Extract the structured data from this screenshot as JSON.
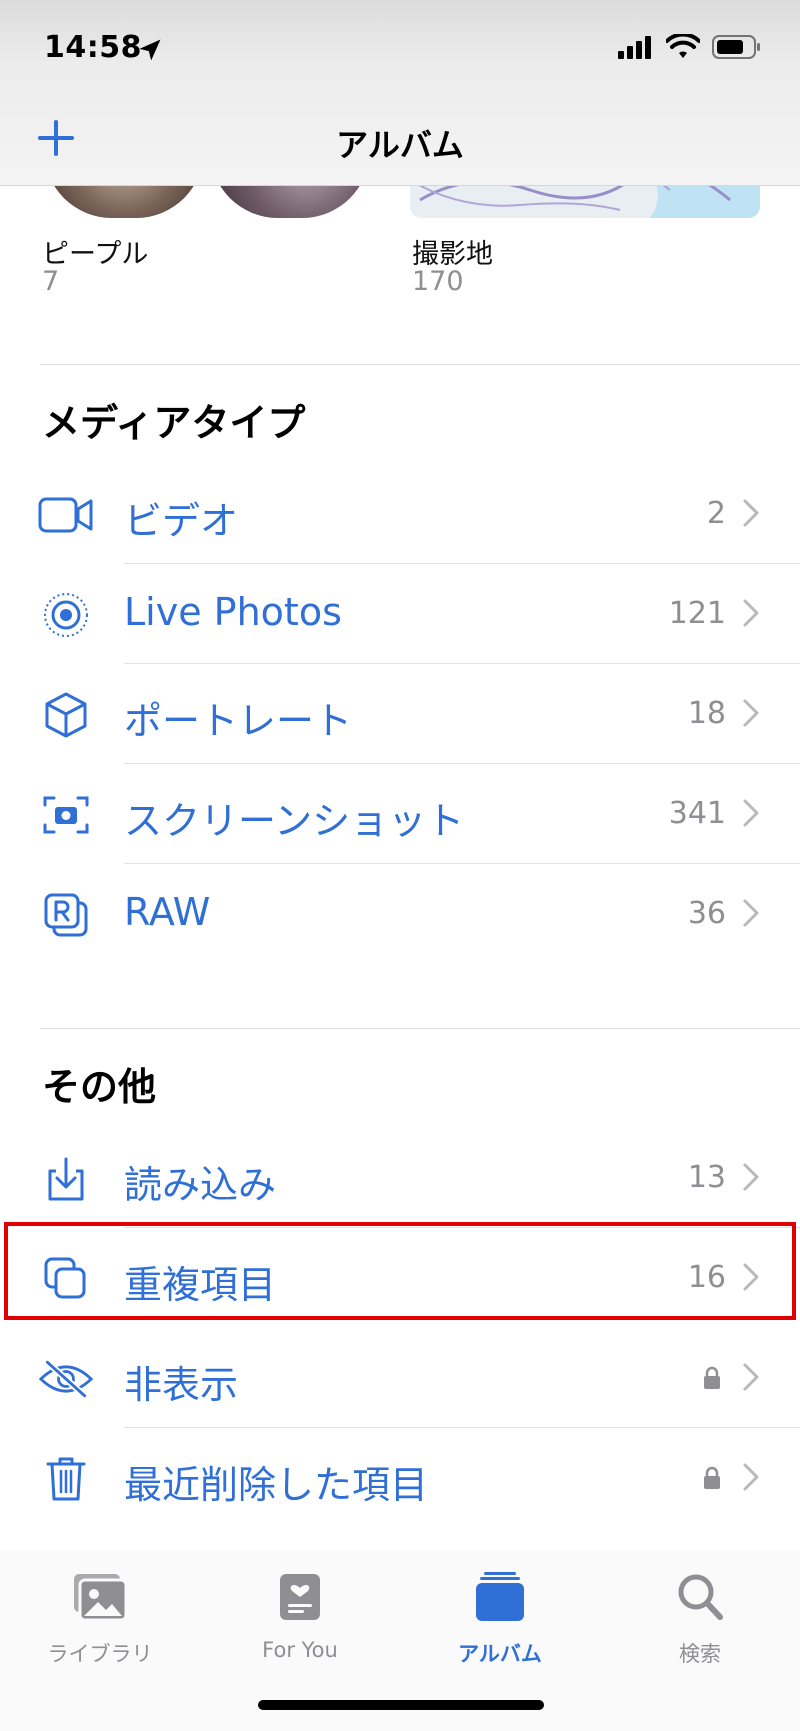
{
  "status": {
    "time": "14:58"
  },
  "nav": {
    "title": "アルバム"
  },
  "strip": {
    "people_label": "ピープル",
    "people_count": "7",
    "places_label": "撮影地",
    "places_count": "170"
  },
  "media_types": {
    "title": "メディアタイプ",
    "items": [
      {
        "label": "ビデオ",
        "count": "2",
        "icon": "video-icon"
      },
      {
        "label": "Live Photos",
        "count": "121",
        "icon": "live-photos-icon"
      },
      {
        "label": "ポートレート",
        "count": "18",
        "icon": "portrait-cube-icon"
      },
      {
        "label": "スクリーンショット",
        "count": "341",
        "icon": "screenshot-icon"
      },
      {
        "label": "RAW",
        "count": "36",
        "icon": "raw-icon"
      }
    ]
  },
  "other": {
    "title": "その他",
    "items": [
      {
        "label": "読み込み",
        "count": "13",
        "icon": "import-icon"
      },
      {
        "label": "重複項目",
        "count": "16",
        "icon": "duplicates-icon",
        "highlighted": true
      },
      {
        "label": "非表示",
        "locked": true,
        "icon": "hidden-eye-icon"
      },
      {
        "label": "最近削除した項目",
        "locked": true,
        "icon": "trash-icon"
      }
    ]
  },
  "tabs": [
    {
      "label": "ライブラリ",
      "icon": "library-icon"
    },
    {
      "label": "For You",
      "icon": "for-you-icon"
    },
    {
      "label": "アルバム",
      "icon": "albums-icon",
      "active": true
    },
    {
      "label": "検索",
      "icon": "search-icon"
    }
  ],
  "colors": {
    "accent": "#2f6fd6",
    "secondary": "#8e8e93",
    "highlight": "#e00000"
  }
}
